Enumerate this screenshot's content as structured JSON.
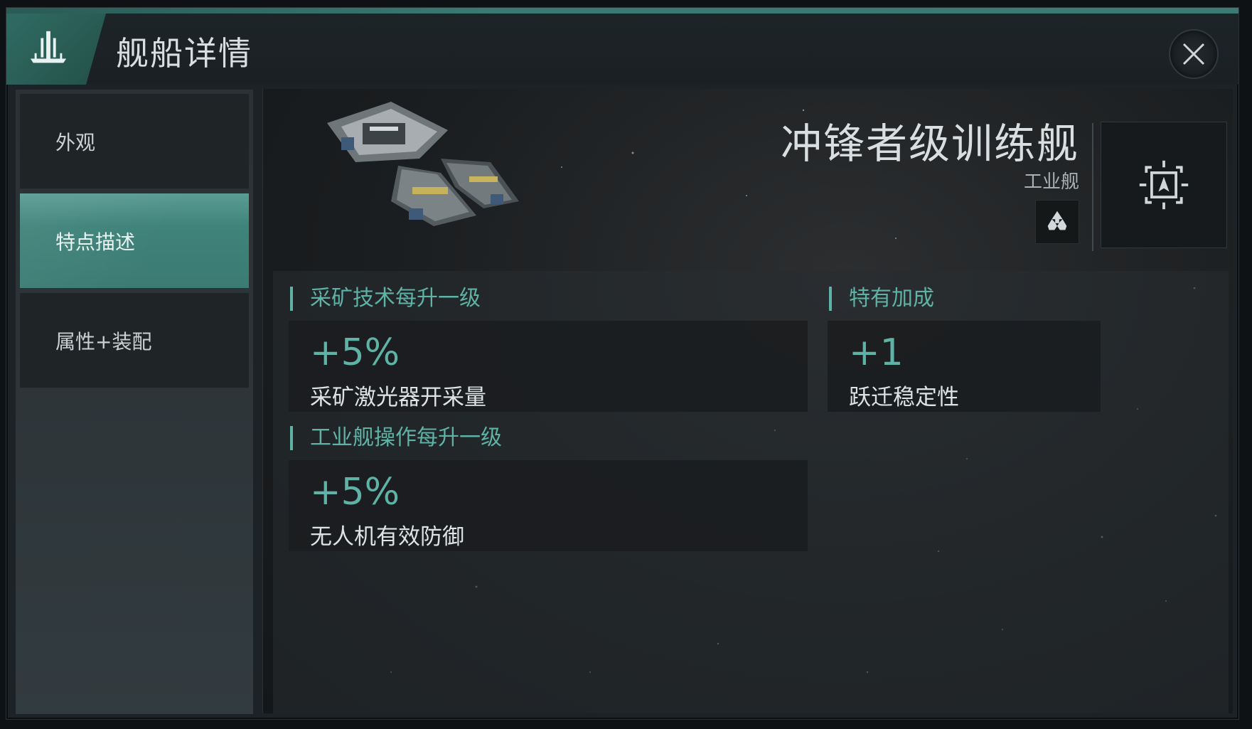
{
  "header": {
    "title": "舰船详情",
    "logo_icon": "ship-fleet-icon",
    "close_icon": "close-icon"
  },
  "sidebar": {
    "items": [
      {
        "label": "外观",
        "active": false
      },
      {
        "label": "特点描述",
        "active": true
      },
      {
        "label": "属性+装配",
        "active": false
      }
    ]
  },
  "ship": {
    "name": "冲锋者级训练舰",
    "class": "工业舰",
    "recycle_icon": "recycle-icon",
    "locate_icon": "locate-target-icon"
  },
  "traits": {
    "section1": {
      "title": "采矿技术每升一级",
      "bonus": {
        "value": "+5%",
        "desc": "采矿激光器开采量"
      }
    },
    "section2": {
      "title": "特有加成",
      "bonus": {
        "value": "+1",
        "desc": "跃迁稳定性"
      }
    },
    "section3": {
      "title": "工业舰操作每升一级",
      "bonus": {
        "value": "+5%",
        "desc": "无人机有效防御"
      }
    }
  },
  "colors": {
    "accent": "#5fb2a6",
    "active_tab": "#3f837a",
    "panel_bg": "#1c2226"
  }
}
